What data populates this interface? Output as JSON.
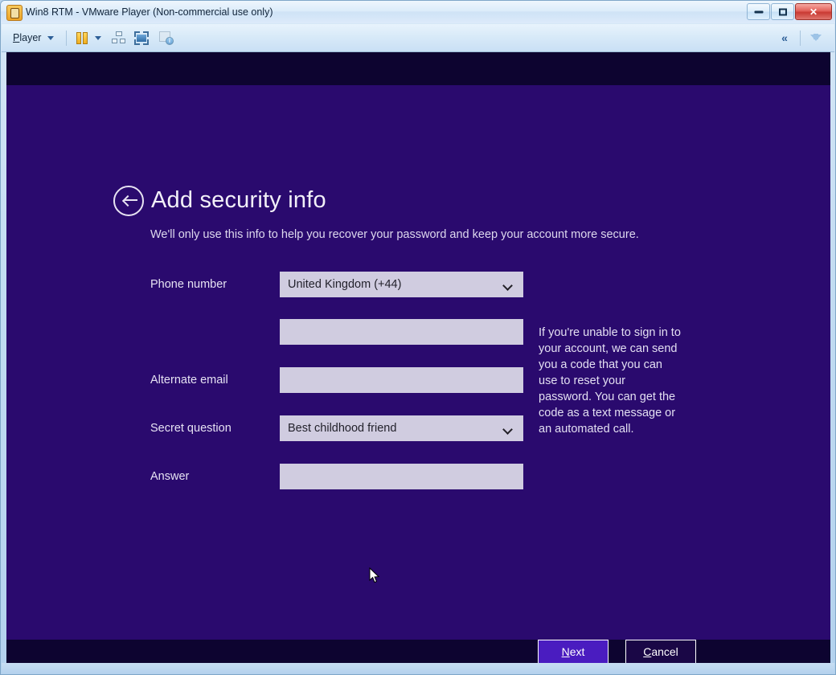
{
  "window": {
    "title": "Win8 RTM - VMware Player (Non-commercial use only)",
    "app_icon": "vmware-player-icon",
    "controls": {
      "minimize": "minimize-icon",
      "restore": "restore-icon",
      "close": "close-icon",
      "close_glyph": "✕"
    }
  },
  "toolbar": {
    "player_menu": "Player",
    "player_menu_accel": "P",
    "player_menu_rest": "layer",
    "icons": [
      "dual-pane-icon",
      "dropdown-caret-icon",
      "removable-devices-icon",
      "full-screen-icon",
      "vm-info-icon"
    ],
    "right_controls": [
      "collapse-chevrons-icon",
      "expand-down-arrow-icon"
    ],
    "collapse_glyph": "«"
  },
  "screen": {
    "back_button": "back-arrow-icon",
    "title": "Add security info",
    "subtitle": "We'll only use this info to help you recover your password and keep your account more secure.",
    "form": [
      {
        "label": "Phone number",
        "type": "select",
        "value": "United Kingdom (+44)",
        "name": "country-code-select"
      },
      {
        "label": "",
        "type": "text",
        "value": "",
        "name": "phone-number-input"
      },
      {
        "label": "Alternate email",
        "type": "text",
        "value": "",
        "name": "alternate-email-input"
      },
      {
        "label": "Secret question",
        "type": "select",
        "value": "Best childhood friend",
        "name": "secret-question-select"
      },
      {
        "label": "Answer",
        "type": "text",
        "value": "",
        "name": "answer-input"
      }
    ],
    "help_text": "If you're unable to sign in to your account, we can send you a code that you can use to reset your password. You can get the code as a text message or an automated call.",
    "buttons": {
      "next": "Next",
      "next_accel": "N",
      "next_rest": "ext",
      "cancel": "Cancel",
      "cancel_accel": "C",
      "cancel_rest": "ancel"
    },
    "colors": {
      "page_background": "#2a0a6e",
      "band_background": "#0d0430",
      "field_background": "#d0cce0",
      "primary_button": "#4a1cc0",
      "secondary_button": "#1a0746",
      "text": "#f2f0f8"
    }
  },
  "status_bar": {
    "text": ""
  }
}
